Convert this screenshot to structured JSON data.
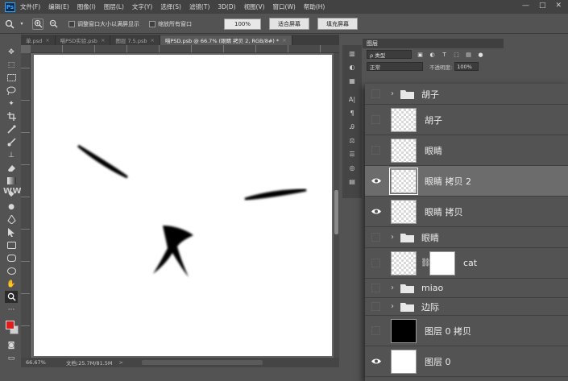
{
  "menu": {
    "logo": "Ps",
    "items": [
      "文件(F)",
      "编辑(E)",
      "图像(I)",
      "图层(L)",
      "文字(Y)",
      "选择(S)",
      "滤镜(T)",
      "3D(D)",
      "视图(V)",
      "窗口(W)",
      "帮助(H)"
    ],
    "window_controls": [
      "—",
      "□",
      "✕"
    ]
  },
  "options": {
    "check_resize": "调整窗口大小以满屏显示",
    "check_all_windows": "缩放所有窗口",
    "zoom_value": "100%",
    "fit_screen": "适合屏幕",
    "fill_screen": "填充屏幕"
  },
  "tabs": [
    {
      "label": "单.psd",
      "close": "×"
    },
    {
      "label": "喵PSD实验.psb",
      "close": "×"
    },
    {
      "label": "图层 7.5.psb",
      "close": "×"
    },
    {
      "label": "喵PSD.psb @ 66.7% (眼睛 拷贝 2, RGB/8#) *",
      "close": "×"
    }
  ],
  "status": {
    "zoom": "66.67%",
    "doc_info": "文档:25.7M/81.5M",
    "arrow": ">"
  },
  "watermark": "WWW",
  "colors": {
    "foreground": "#e01d1d",
    "background": "#d0d0d0",
    "selected_row": "#6c6c6c"
  },
  "small_panel": {
    "title": "图层",
    "kind_select": "ρ 类型",
    "blend_mode": "正常",
    "opacity_label": "不透明度:",
    "opacity_value": "100%"
  },
  "layers": [
    {
      "type": "group",
      "name": "胡子",
      "visible": false
    },
    {
      "type": "layer",
      "name": "胡子",
      "visible": false,
      "thumb": "transparent"
    },
    {
      "type": "layer",
      "name": "眼睛",
      "visible": false,
      "thumb": "transparent"
    },
    {
      "type": "layer",
      "name": "眼睛 拷贝 2",
      "visible": true,
      "thumb": "transparent",
      "selected": true
    },
    {
      "type": "layer",
      "name": "眼睛 拷贝",
      "visible": true,
      "thumb": "transparent"
    },
    {
      "type": "group",
      "name": "眼睛",
      "visible": false
    },
    {
      "type": "masked",
      "name": "cat",
      "visible": false,
      "thumb": "transparent"
    },
    {
      "type": "group",
      "name": "miao",
      "visible": false
    },
    {
      "type": "group",
      "name": "边际",
      "visible": false
    },
    {
      "type": "layer",
      "name": "图层 0 拷贝",
      "visible": false,
      "thumb": "black"
    },
    {
      "type": "layer",
      "name": "图层 0",
      "visible": true,
      "thumb": "white"
    }
  ]
}
